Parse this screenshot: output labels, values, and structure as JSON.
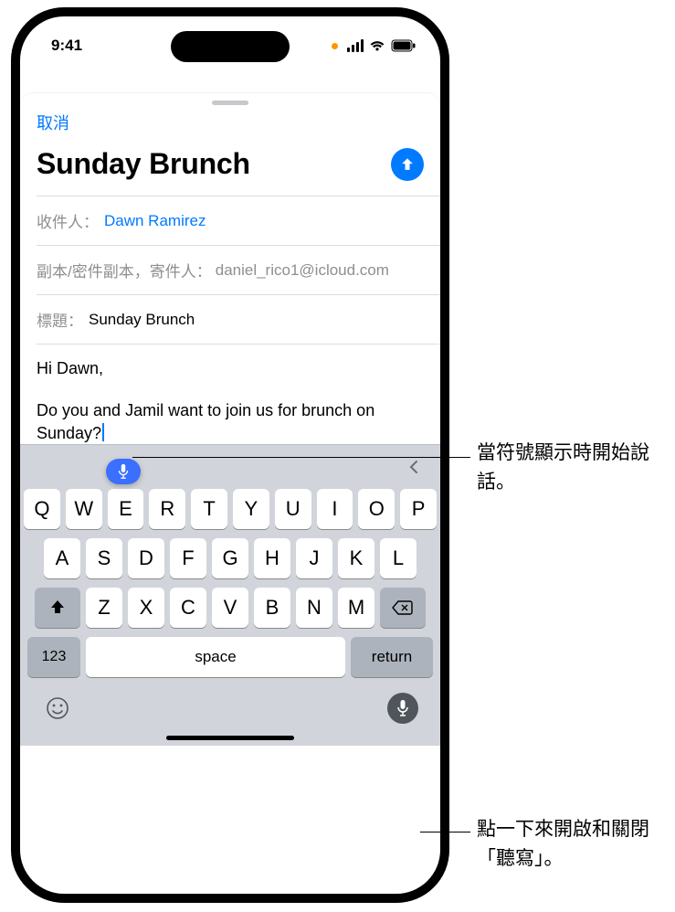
{
  "status": {
    "time": "9:41"
  },
  "nav": {
    "cancel": "取消"
  },
  "compose": {
    "title": "Sunday Brunch",
    "to_label": "收件人：",
    "to_value": "Dawn Ramirez",
    "cc_label": "副本/密件副本，寄件人：",
    "cc_value": "daniel_rico1@icloud.com",
    "subject_label": "標題：",
    "subject_value": "Sunday Brunch",
    "body_greeting": "Hi Dawn,",
    "body_text": "Do you and Jamil want to join us for brunch on Sunday?"
  },
  "keyboard": {
    "row1": [
      "Q",
      "W",
      "E",
      "R",
      "T",
      "Y",
      "U",
      "I",
      "O",
      "P"
    ],
    "row2": [
      "A",
      "S",
      "D",
      "F",
      "G",
      "H",
      "J",
      "K",
      "L"
    ],
    "row3": [
      "Z",
      "X",
      "C",
      "V",
      "B",
      "N",
      "M"
    ],
    "numKey": "123",
    "space": "space",
    "return": "return"
  },
  "callouts": {
    "dictation_indicator": "當符號顯示時開始說話。",
    "mic_button": "點一下來開啟和關閉「聽寫」。"
  }
}
